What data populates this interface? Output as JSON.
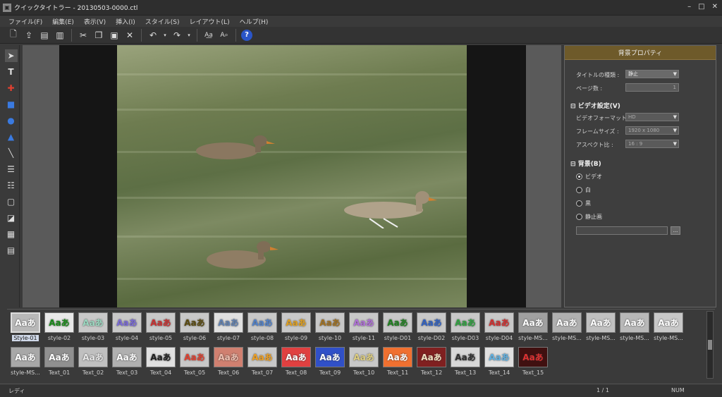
{
  "window": {
    "title": "クイックタイトラー - 20130503-0000.ctl",
    "app_icon": "ctl-app-icon"
  },
  "menu": [
    "ファイル(F)",
    "編集(E)",
    "表示(V)",
    "挿入(I)",
    "スタイル(S)",
    "レイアウト(L)",
    "ヘルプ(H)"
  ],
  "toolbar": {
    "icons": [
      "new-icon",
      "open-icon",
      "save-icon",
      "save-as-icon",
      "cut-icon",
      "copy-icon",
      "paste-icon",
      "delete-icon",
      "undo-icon",
      "undo-dropdown-icon",
      "redo-icon",
      "redo-dropdown-icon",
      "text-format-icon",
      "text-search-icon",
      "help-icon"
    ],
    "help_label": "?"
  },
  "left_tools": [
    "pointer-tool-icon",
    "text-tool-icon",
    "crosshair-tool-icon",
    "rectangle-tool-icon",
    "ellipse-tool-icon",
    "triangle-tool-icon",
    "line-tool-icon",
    "align-icon",
    "distribute-icon",
    "frame-icon",
    "shadow-icon",
    "grid-icon",
    "table-icon"
  ],
  "properties": {
    "header": "背景プロパティ",
    "title_type_label": "タイトルの種類 :",
    "title_type_value": "静止",
    "pages_label": "ページ数 :",
    "pages_value": "1",
    "video_section": "ビデオ設定(V)",
    "video_format_label": "ビデオフォーマット :",
    "video_format_value": "HD",
    "frame_size_label": "フレームサイズ :",
    "frame_size_value": "1920 x 1080",
    "aspect_label": "アスペクト比 :",
    "aspect_value": "16 : 9",
    "bg_section": "背景(B)",
    "bg_options": [
      "ビデオ",
      "白",
      "黒",
      "静止画"
    ],
    "bg_selected": "ビデオ",
    "browse_label": "..."
  },
  "styles": {
    "thumb_text": "Aaあ",
    "row1": [
      {
        "name": "Style-01",
        "color": "#ffffff",
        "bg": "#b8b8b8"
      },
      {
        "name": "style-02",
        "color": "#1a8a1a",
        "bg": "#e8e8e8"
      },
      {
        "name": "style-03",
        "color": "#9ad8c0",
        "bg": "#c8c8c8"
      },
      {
        "name": "style-04",
        "color": "#7a6ad8",
        "bg": "#c8c8c8"
      },
      {
        "name": "style-05",
        "color": "#c83030",
        "bg": "#c8c8c8"
      },
      {
        "name": "style-06",
        "color": "#5a4a10",
        "bg": "#c8c8c8"
      },
      {
        "name": "style-07",
        "color": "#6080b0",
        "bg": "#e0e0e0"
      },
      {
        "name": "style-08",
        "color": "#5080c8",
        "bg": "#c8c8c8"
      },
      {
        "name": "style-09",
        "color": "#e0a020",
        "bg": "#c8c8c8"
      },
      {
        "name": "style-10",
        "color": "#a07020",
        "bg": "#c8c8c8"
      },
      {
        "name": "style-11",
        "color": "#b070d8",
        "bg": "#c8c8c8"
      },
      {
        "name": "style-D01",
        "color": "#208020",
        "bg": "#c8c8c8"
      },
      {
        "name": "style-D02",
        "color": "#3060c0",
        "bg": "#c8c8c8"
      },
      {
        "name": "style-D03",
        "color": "#30a040",
        "bg": "#c8c8c8"
      },
      {
        "name": "style-D04",
        "color": "#d03030",
        "bg": "#c8c8c8"
      },
      {
        "name": "style-MS...",
        "color": "#ffffff",
        "bg": "#a0a0a0"
      },
      {
        "name": "style-MS...",
        "color": "#ffffff",
        "bg": "#b0b0b0"
      },
      {
        "name": "style-MS...",
        "color": "#ffffff",
        "bg": "#c0c0c0"
      },
      {
        "name": "style-MS...",
        "color": "#ffffff",
        "bg": "#b8b8b8"
      },
      {
        "name": "style-MS...",
        "color": "#ffffff",
        "bg": "#c8c8c8"
      }
    ],
    "row2": [
      {
        "name": "style-MS...",
        "color": "#ffffff",
        "bg": "#a8a8a8"
      },
      {
        "name": "Text_01",
        "color": "#ffffff",
        "bg": "#909090"
      },
      {
        "name": "Text_02",
        "color": "#e8e8e8",
        "bg": "#c0c0c0"
      },
      {
        "name": "Text_03",
        "color": "#ffffff",
        "bg": "#b0b0b0"
      },
      {
        "name": "Text_04",
        "color": "#202020",
        "bg": "#e0e0e0"
      },
      {
        "name": "Text_05",
        "color": "#e04030",
        "bg": "#c8c8c8"
      },
      {
        "name": "Text_06",
        "color": "#f0c0b0",
        "bg": "#d08070"
      },
      {
        "name": "Text_07",
        "color": "#f0a020",
        "bg": "#c8c8c8"
      },
      {
        "name": "Text_08",
        "color": "#ffffff",
        "bg": "#e04040"
      },
      {
        "name": "Text_09",
        "color": "#ffffff",
        "bg": "#3050c8"
      },
      {
        "name": "Text_10",
        "color": "#e0d080",
        "bg": "#c8c8c8"
      },
      {
        "name": "Text_11",
        "color": "#ffffff",
        "bg": "#f07030"
      },
      {
        "name": "Text_12",
        "color": "#f0e0c0",
        "bg": "#802020"
      },
      {
        "name": "Text_13",
        "color": "#303030",
        "bg": "#d8d8d8"
      },
      {
        "name": "Text_14",
        "color": "#60b0e0",
        "bg": "#e0e0e0"
      },
      {
        "name": "Text_15",
        "color": "#e03030",
        "bg": "#401010"
      }
    ]
  },
  "status": {
    "left": "レディ",
    "page": "1 / 1",
    "mode": "NUM"
  }
}
